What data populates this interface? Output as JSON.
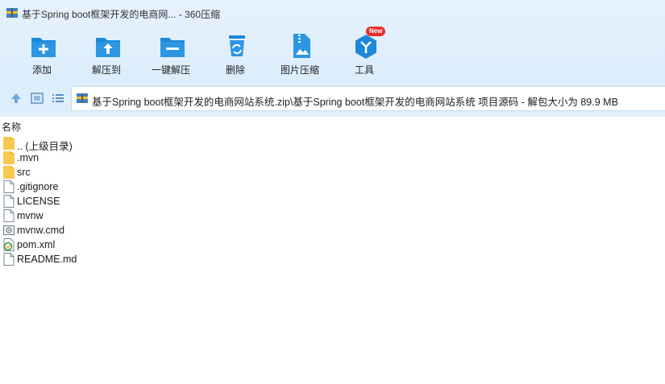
{
  "window": {
    "title": "基于Spring boot框架开发的电商网... - 360压缩"
  },
  "toolbar": {
    "items": [
      {
        "label": "添加",
        "icon": "add-icon"
      },
      {
        "label": "解压到",
        "icon": "extract-to-icon"
      },
      {
        "label": "一键解压",
        "icon": "one-click-extract-icon"
      },
      {
        "label": "删除",
        "icon": "delete-icon"
      },
      {
        "label": "图片压缩",
        "icon": "image-compress-icon"
      },
      {
        "label": "工具",
        "icon": "tools-icon"
      }
    ],
    "tools_badge": "New"
  },
  "nav": {
    "address": "基于Spring boot框架开发的电商网站系统.zip\\基于Spring boot框架开发的电商网站系统 项目源码 - 解包大小为 89.9 MB"
  },
  "list": {
    "column_name": "名称",
    "files": [
      {
        "name": ".. (上级目录)",
        "type": "folder"
      },
      {
        "name": ".mvn",
        "type": "folder"
      },
      {
        "name": "src",
        "type": "folder"
      },
      {
        "name": ".gitignore",
        "type": "file"
      },
      {
        "name": "LICENSE",
        "type": "file"
      },
      {
        "name": "mvnw",
        "type": "file"
      },
      {
        "name": "mvnw.cmd",
        "type": "cmd"
      },
      {
        "name": "pom.xml",
        "type": "xml"
      },
      {
        "name": "README.md",
        "type": "file"
      }
    ]
  },
  "colors": {
    "accent": "#1e88d8",
    "toolbar_bg": "#dcedfb",
    "folder": "#f7c94e",
    "badge": "#e8302b"
  }
}
